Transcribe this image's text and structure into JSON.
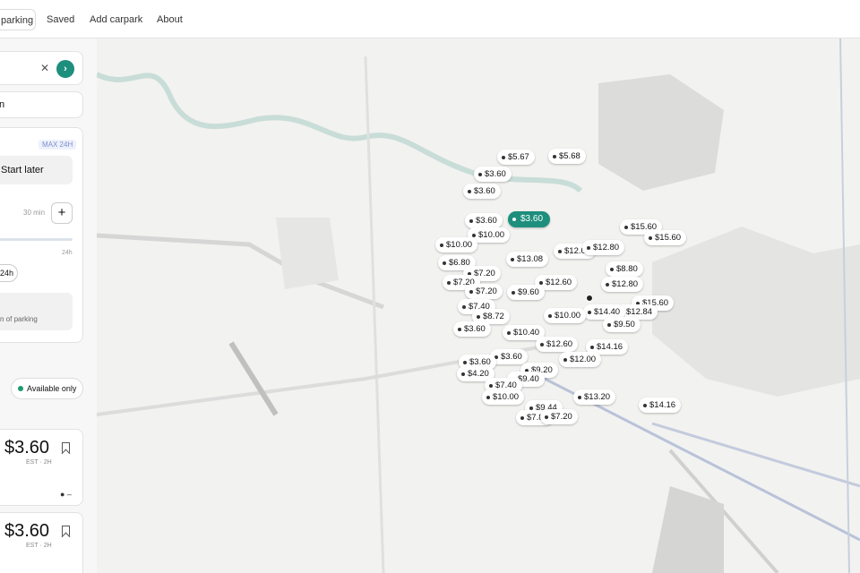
{
  "nav": {
    "tabs": [
      {
        "label": "parking",
        "active": true
      },
      {
        "label": "Saved"
      },
      {
        "label": "Add carpark"
      },
      {
        "label": "About"
      }
    ]
  },
  "search": {
    "clear_icon": "close-icon",
    "go_icon": "chevron-right-icon"
  },
  "location": {
    "label": "n"
  },
  "time": {
    "badge": "MAX 24H",
    "start_later": "Start later",
    "duration_value": "30 min",
    "slider_end": "24h",
    "chip": "24h",
    "info": "n of parking"
  },
  "filters": {
    "available_only": "Available only"
  },
  "results": [
    {
      "price": "$3.60",
      "est": "EST · 2H"
    },
    {
      "price": "$3.60",
      "est": "EST · 2H"
    }
  ],
  "map": {
    "accent": "#1d8f7c",
    "pins": [
      {
        "label": "$5.67"
      },
      {
        "label": "$5.68"
      },
      {
        "label": "$3.60"
      },
      {
        "label": "$3.60"
      },
      {
        "label": "$3.60",
        "selected": true
      },
      {
        "label": "$3.60"
      },
      {
        "label": "$10.00"
      },
      {
        "label": "$15.60"
      },
      {
        "label": "$15.60"
      },
      {
        "label": "$10.00"
      },
      {
        "label": "$12.00"
      },
      {
        "label": "$12.80"
      },
      {
        "label": "$6.80"
      },
      {
        "label": "$13.08"
      },
      {
        "label": "$8.80"
      },
      {
        "label": "$7.20"
      },
      {
        "label": "$7.20"
      },
      {
        "label": "$7.20"
      },
      {
        "label": "$12.60"
      },
      {
        "label": "$12.80"
      },
      {
        "label": "$9.60"
      },
      {
        "label": "$15.60"
      },
      {
        "label": "$12.84"
      },
      {
        "label": "$7.40"
      },
      {
        "label": "$8.72"
      },
      {
        "label": "$14.40"
      },
      {
        "label": "$10.00"
      },
      {
        "label": "$9.50"
      },
      {
        "label": "$3.60"
      },
      {
        "label": "$10.40"
      },
      {
        "label": "$12.60"
      },
      {
        "label": "$14.16"
      },
      {
        "label": "$3.60"
      },
      {
        "label": "$3.60"
      },
      {
        "label": "$12.00"
      },
      {
        "label": "$4.20"
      },
      {
        "label": "$9.20"
      },
      {
        "label": "$9.40"
      },
      {
        "label": "$7.40"
      },
      {
        "label": "$10.00"
      },
      {
        "label": "$13.20"
      },
      {
        "label": "$14.16"
      },
      {
        "label": "$9.44"
      },
      {
        "label": "$7.80"
      },
      {
        "label": "$7.20"
      }
    ]
  }
}
